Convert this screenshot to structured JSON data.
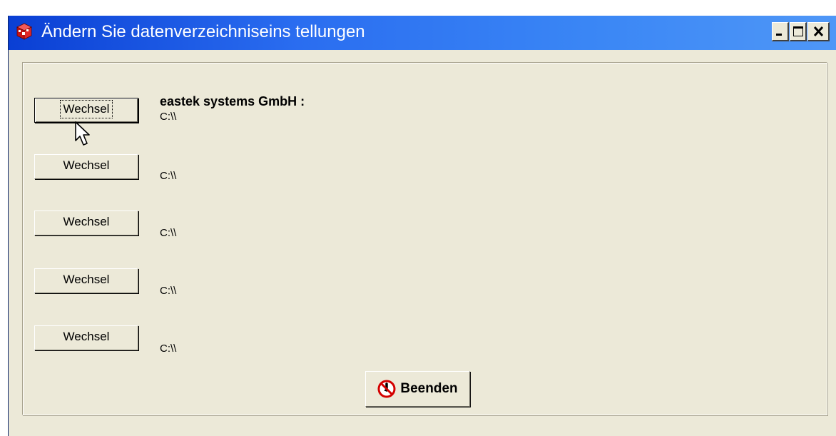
{
  "window": {
    "title": "Ändern Sie datenverzeichniseins tellungen",
    "icons": {
      "app": "red-3d-box-icon",
      "minimize": "minimize-icon",
      "maximize": "maximize-icon",
      "close": "close-icon"
    }
  },
  "company_label": "eastek systems GmbH :",
  "entries": [
    {
      "button_label": "Wechsel",
      "path": "C:\\\\"
    },
    {
      "button_label": "Wechsel",
      "path": "C:\\\\"
    },
    {
      "button_label": "Wechsel",
      "path": "C:\\\\"
    },
    {
      "button_label": "Wechsel",
      "path": "C:\\\\"
    },
    {
      "button_label": "Wechsel",
      "path": "C:\\\\"
    }
  ],
  "footer": {
    "exit_label": "Beenden",
    "exit_icon": "stop-icon"
  },
  "colors": {
    "titlebar": "#2a6df0",
    "dialog_bg": "#ece9d8",
    "stop_red": "#d40000"
  }
}
